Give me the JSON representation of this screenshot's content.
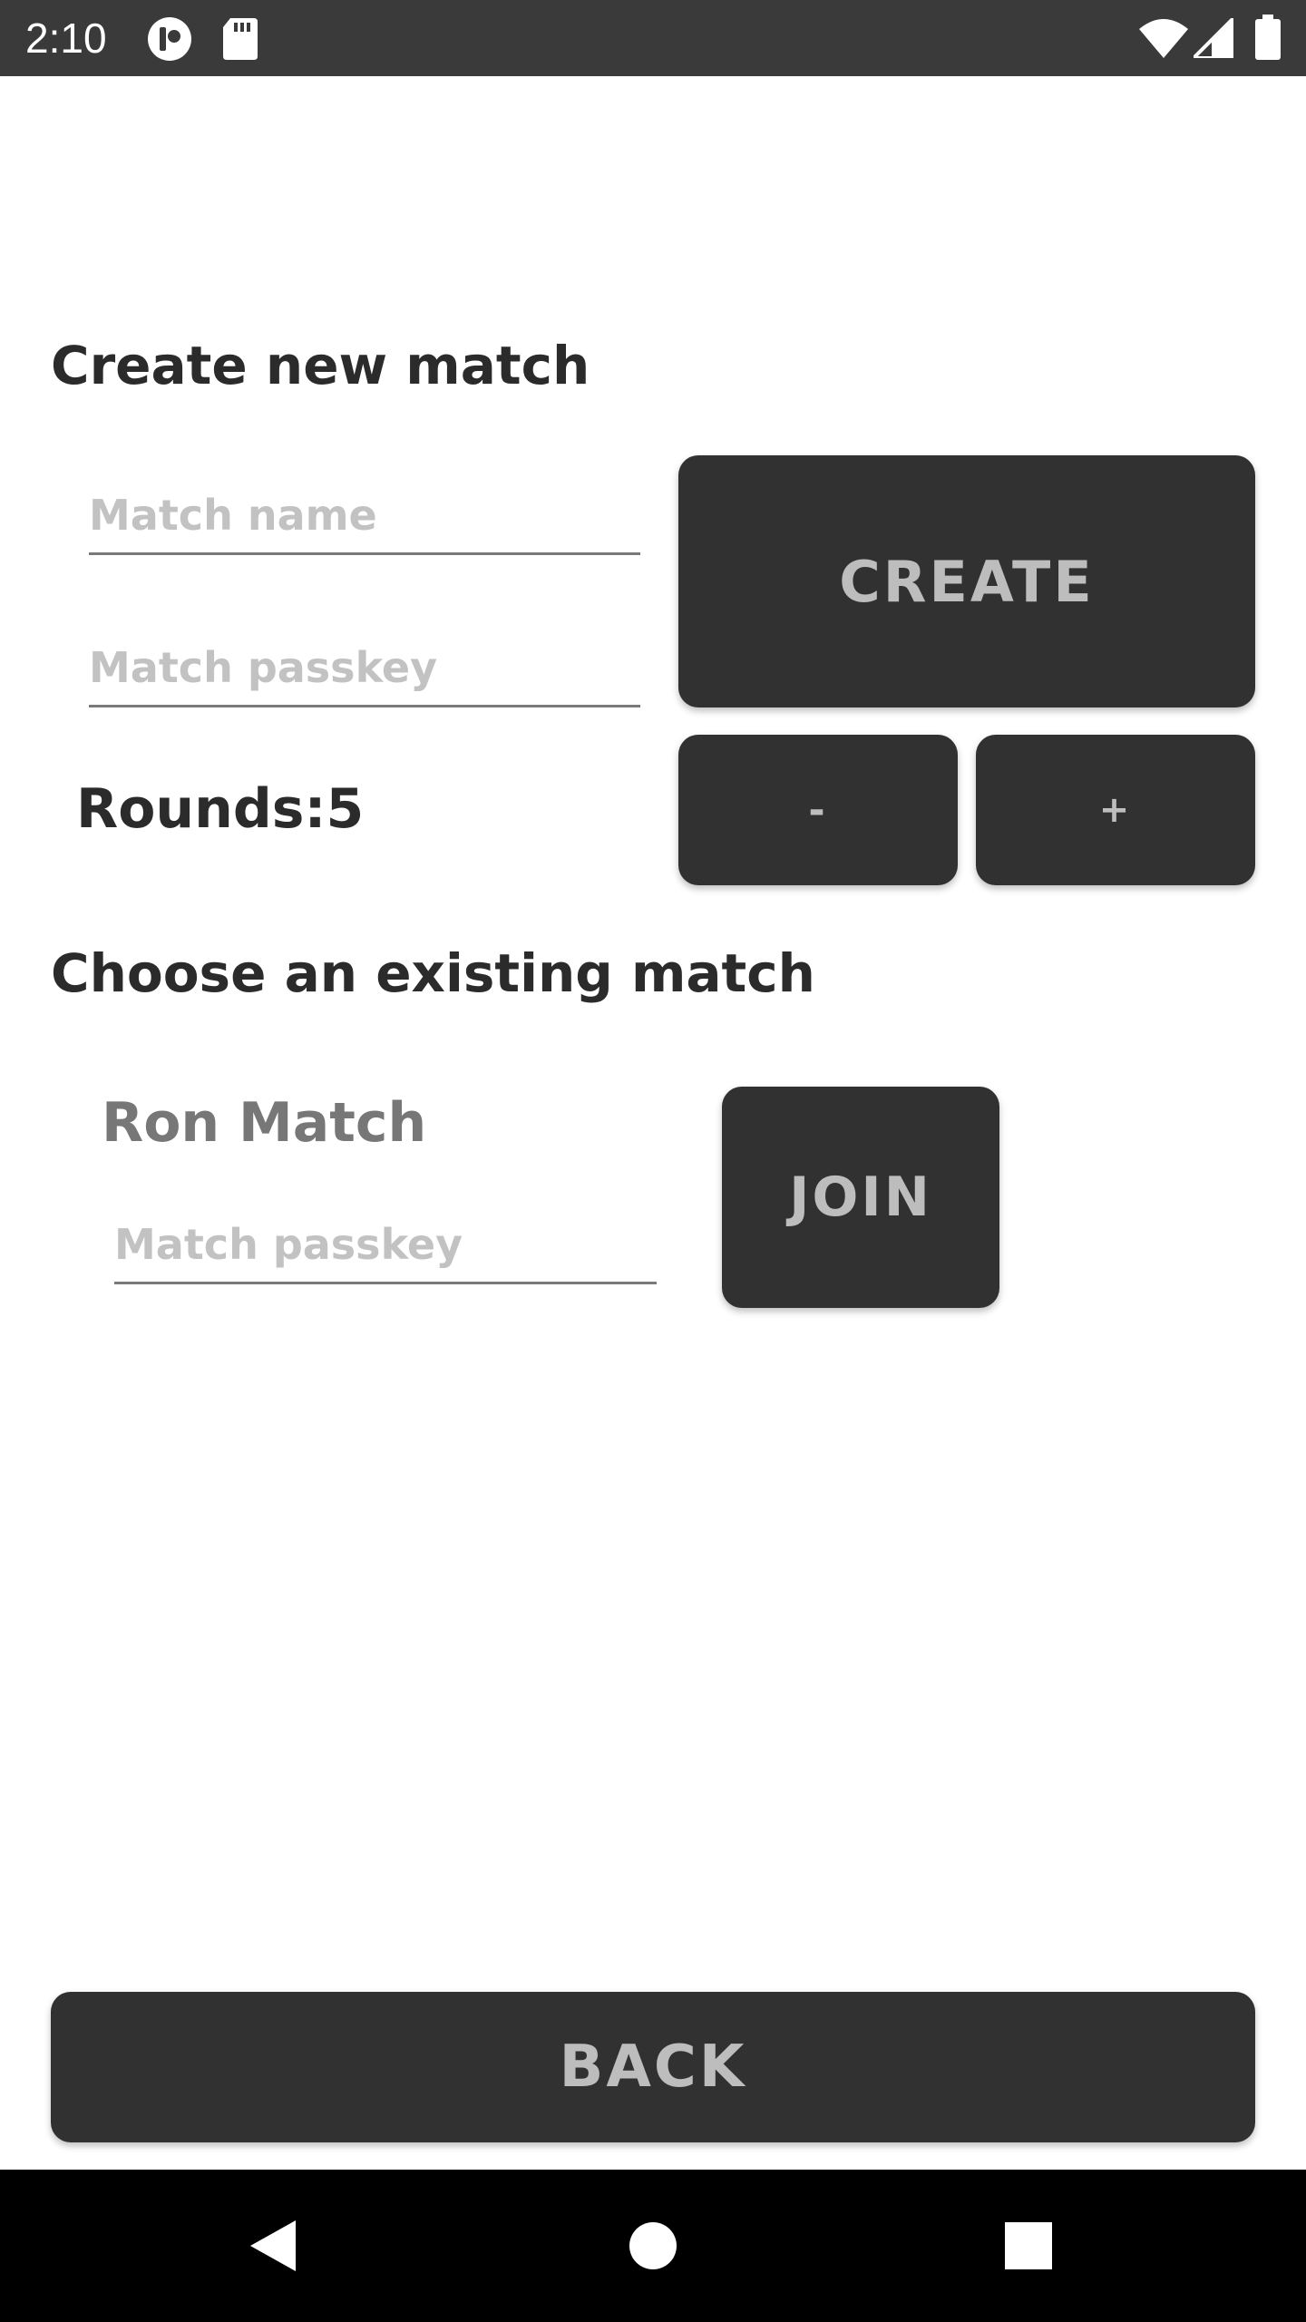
{
  "status_bar": {
    "time": "2:10",
    "icons": [
      "app-notification-icon",
      "sd-card-icon",
      "wifi-icon",
      "signal-icon",
      "battery-icon"
    ]
  },
  "create_section": {
    "title": "Create new match",
    "match_name_placeholder": "Match name",
    "match_passkey_placeholder": "Match passkey",
    "create_label": "CREATE",
    "rounds_label": "Rounds:5",
    "minus_label": "-",
    "plus_label": "+"
  },
  "existing_section": {
    "title": "Choose an existing match",
    "matches": [
      {
        "name": "Ron Match",
        "passkey_placeholder": "Match passkey",
        "join_label": "JOIN"
      }
    ]
  },
  "back_label": "BACK",
  "nav_bar": {
    "icons": [
      "back-triangle-icon",
      "home-circle-icon",
      "recents-square-icon"
    ]
  },
  "colors": {
    "status_bar": "#3a3a3a",
    "button_bg": "#313131",
    "button_text": "#bdbdbd",
    "heading_text": "#2b2b2b",
    "placeholder_text": "#c2c2c2",
    "nav_bar": "#000000"
  }
}
